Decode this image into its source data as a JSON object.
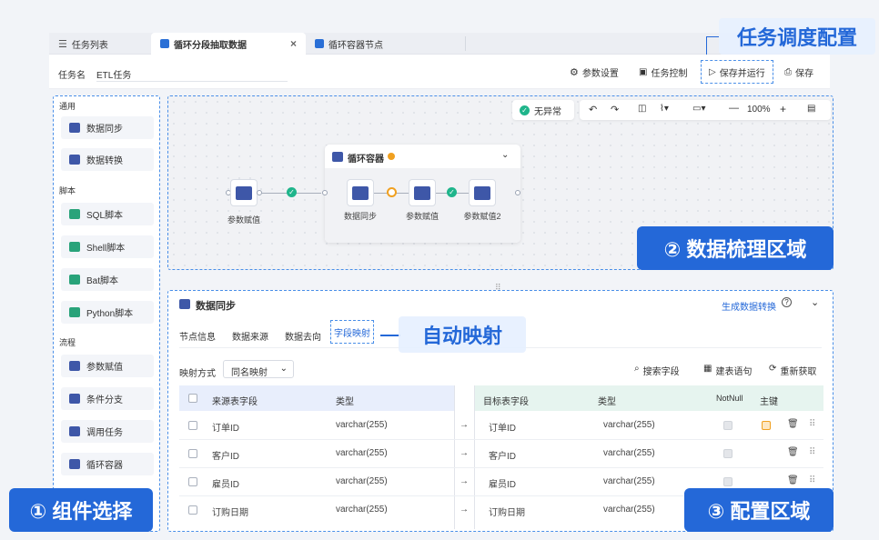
{
  "tabs": [
    {
      "label": "任务列表"
    },
    {
      "label": "循环分段抽取数据"
    },
    {
      "label": "循环容器节点"
    }
  ],
  "tab_close": "×",
  "task": {
    "name_label": "任务名",
    "name_value": "ETL任务"
  },
  "toolbar": {
    "params": "参数设置",
    "control": "任务控制",
    "save_run": "保存并运行",
    "save": "保存"
  },
  "left": {
    "sections": {
      "common": "通用",
      "script": "脚本",
      "flow": "流程"
    },
    "items": [
      "数据同步",
      "数据转换",
      "SQL脚本",
      "Shell脚本",
      "Bat脚本",
      "Python脚本",
      "参数赋值",
      "条件分支",
      "调用任务",
      "循环容器"
    ]
  },
  "canvas": {
    "status": "无异常",
    "zoom": "100%",
    "zoom_minus": "—",
    "zoom_plus": "+",
    "container_title": "循环容器",
    "nodes": [
      "参数赋值",
      "数据同步",
      "参数赋值",
      "参数赋值2"
    ]
  },
  "config": {
    "title": "数据同步",
    "generate": "生成数据转换",
    "tabs": [
      "节点信息",
      "数据来源",
      "数据去向",
      "字段映射"
    ],
    "map_label": "映射方式",
    "map_value": "同名映射",
    "search": "搜索字段",
    "build": "建表语句",
    "refetch": "重新获取",
    "src_headers": [
      "来源表字段",
      "类型"
    ],
    "tgt_headers": [
      "目标表字段",
      "类型",
      "NotNull",
      "主键"
    ],
    "rows": [
      {
        "src": "订单ID",
        "stype": "varchar(255)",
        "tgt": "订单ID",
        "ttype": "varchar(255)"
      },
      {
        "src": "客户ID",
        "stype": "varchar(255)",
        "tgt": "客户ID",
        "ttype": "varchar(255)"
      },
      {
        "src": "雇员ID",
        "stype": "varchar(255)",
        "tgt": "雇员ID",
        "ttype": "varchar(255)"
      },
      {
        "src": "订购日期",
        "stype": "varchar(255)",
        "tgt": "订购日期",
        "ttype": "varchar(255)"
      }
    ],
    "arrow": "→"
  },
  "callouts": {
    "schedule": "任务调度配置",
    "auto": "自动映射",
    "region1": "① 组件选择",
    "region2": "② 数据梳理区域",
    "region3": "③ 配置区域"
  },
  "colors": {
    "accent": "#2468d8",
    "success": "#1fb58b",
    "warn": "#f0a020"
  }
}
